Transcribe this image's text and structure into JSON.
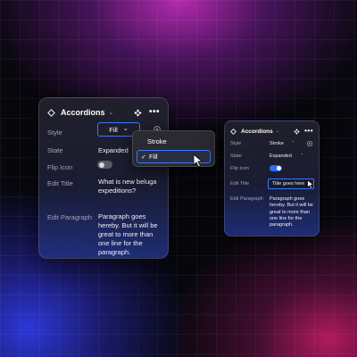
{
  "colors": {
    "accent": "#3a78ff",
    "toggle_on": "#2d6cf5",
    "toggle_off": "#5a5a66",
    "panel_bg": "#22222c",
    "label": "#a4a4b4"
  },
  "icons": {
    "header_left": "diamond-icon",
    "header_component": "component-icon",
    "header_more": "more-dots-icon",
    "chevron": "chevron-down-icon",
    "check": "check-icon",
    "gear": "gear-icon",
    "pointer": "mouse-pointer-icon"
  },
  "big_panel": {
    "title": "Accordions",
    "chevron": "⌄",
    "more": "•••",
    "rows": {
      "style": {
        "label": "Style",
        "value": "Fill"
      },
      "state": {
        "label": "State",
        "value": "Expanded"
      },
      "flip_icon": {
        "label": "Flip Icon",
        "enabled": false
      },
      "edit_title": {
        "label": "Edit Title",
        "value": "What is new beluga expeditions?"
      },
      "edit_paragraph": {
        "label": "Edit Paragraph",
        "value": "Paragraph goes hereby. But it will be great to more than one line for the paragraph."
      }
    },
    "dropdown": {
      "open": true,
      "selected": "Fill",
      "options": [
        "Stroke",
        "Fill"
      ],
      "check": "✓",
      "chevron": "⌄"
    }
  },
  "small_panel": {
    "title": "Accordions",
    "chevron": "⌄",
    "more": "•••",
    "rows": {
      "style": {
        "label": "Style",
        "value": "Stroke",
        "chevron": "⌄"
      },
      "state": {
        "label": "State",
        "value": "Expanded",
        "chevron": "⌄"
      },
      "flip_icon": {
        "label": "Flip Icon",
        "enabled": true
      },
      "edit_title": {
        "label": "Edit Title",
        "value": "Title goes here"
      },
      "edit_paragraph": {
        "label": "Edit Paragraph",
        "value": "Paragraph goes hereby. But it will be great to more than one line for the paragraph."
      }
    }
  }
}
